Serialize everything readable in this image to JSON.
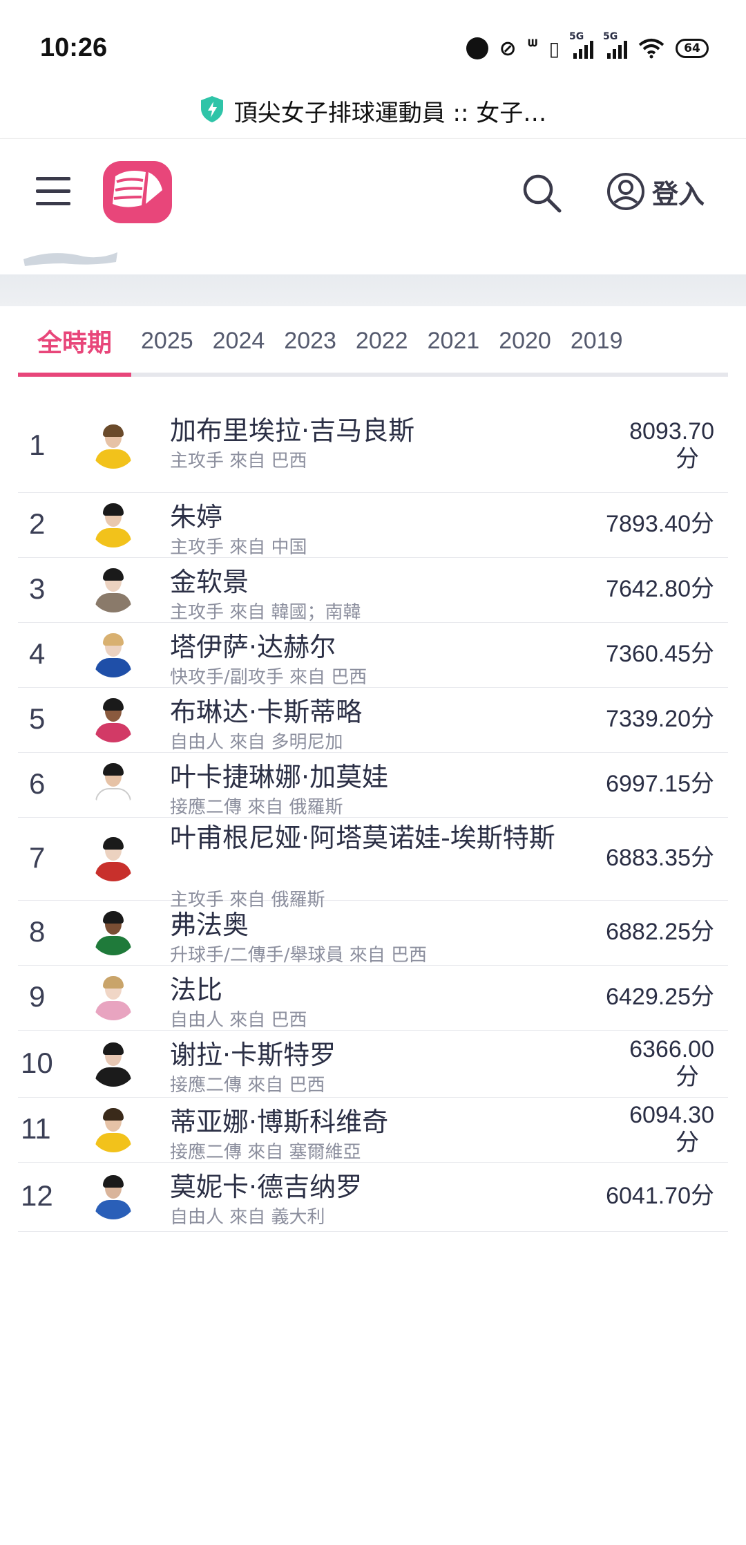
{
  "status_bar": {
    "time": "10:26",
    "battery": "64",
    "net1": "5G",
    "net2": "5G"
  },
  "browser": {
    "title": "頂尖女子排球運動員 :: 女子…",
    "shield_icon": "shield-bolt-icon"
  },
  "header": {
    "login_label": "登入"
  },
  "tabs": [
    {
      "label": "全時期",
      "active": true
    },
    {
      "label": "2025"
    },
    {
      "label": "2024"
    },
    {
      "label": "2023"
    },
    {
      "label": "2022"
    },
    {
      "label": "2021"
    },
    {
      "label": "2020"
    },
    {
      "label": "2019"
    }
  ],
  "players": [
    {
      "rank": "1",
      "name": "加布里埃拉·吉马良斯",
      "sub": "主攻手 來自 巴西",
      "score_line1": "8093.70",
      "score_line2": "分"
    },
    {
      "rank": "2",
      "name": "朱婷",
      "sub": "主攻手 來自 中国",
      "score_line1": "7893.40分",
      "score_line2": ""
    },
    {
      "rank": "3",
      "name": "金软景",
      "sub": "主攻手 來自 韓國；南韓",
      "score_line1": "7642.80分",
      "score_line2": ""
    },
    {
      "rank": "4",
      "name": "塔伊萨·达赫尔",
      "sub": "快攻手/副攻手 來自 巴西",
      "score_line1": "7360.45分",
      "score_line2": ""
    },
    {
      "rank": "5",
      "name": "布琳达·卡斯蒂略",
      "sub": "自由人 來自 多明尼加",
      "score_line1": "7339.20分",
      "score_line2": ""
    },
    {
      "rank": "6",
      "name": "叶卡捷琳娜·加莫娃",
      "sub": "接應二傳 來自 俄羅斯",
      "score_line1": "6997.15分",
      "score_line2": ""
    },
    {
      "rank": "7",
      "name": "叶甫根尼娅·阿塔莫诺娃-埃斯特斯",
      "sub": "主攻手 來自 俄羅斯",
      "score_line1": "6883.35分",
      "score_line2": ""
    },
    {
      "rank": "8",
      "name": "弗法奥",
      "sub": "升球手/二傳手/舉球員 來自 巴西",
      "score_line1": "6882.25分",
      "score_line2": ""
    },
    {
      "rank": "9",
      "name": "法比",
      "sub": "自由人 來自 巴西",
      "score_line1": "6429.25分",
      "score_line2": ""
    },
    {
      "rank": "10",
      "name": "谢拉·卡斯特罗",
      "sub": "接應二傳 來自 巴西",
      "score_line1": "6366.00",
      "score_line2": "分"
    },
    {
      "rank": "11",
      "name": "蒂亚娜·博斯科维奇",
      "sub": "接應二傳 來自 塞爾維亞",
      "score_line1": "6094.30",
      "score_line2": "分"
    },
    {
      "rank": "12",
      "name": "莫妮卡·德吉纳罗",
      "sub": "自由人 來自 義大利",
      "score_line1": "6041.70分",
      "score_line2": ""
    }
  ],
  "colors": {
    "accent": "#e8467a",
    "text": "#2b2f45",
    "muted": "#8c8f9e"
  }
}
